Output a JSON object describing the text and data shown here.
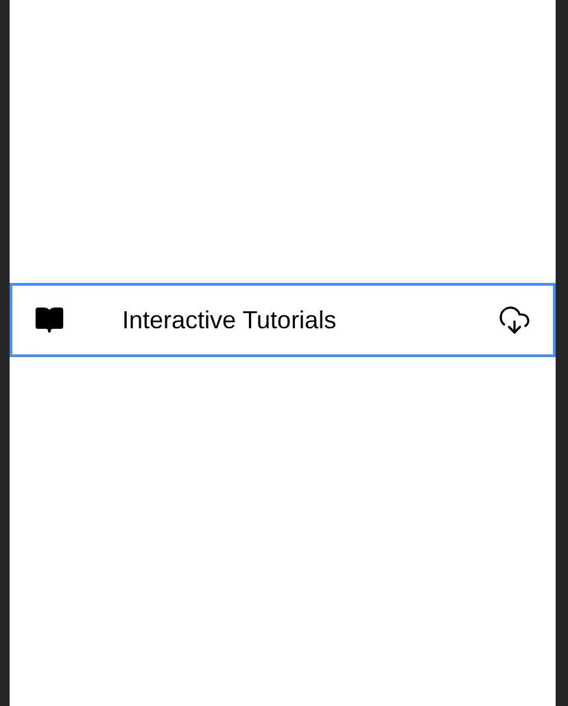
{
  "rows": [
    {
      "label": "Interactive Tutorials",
      "selected": true
    }
  ]
}
